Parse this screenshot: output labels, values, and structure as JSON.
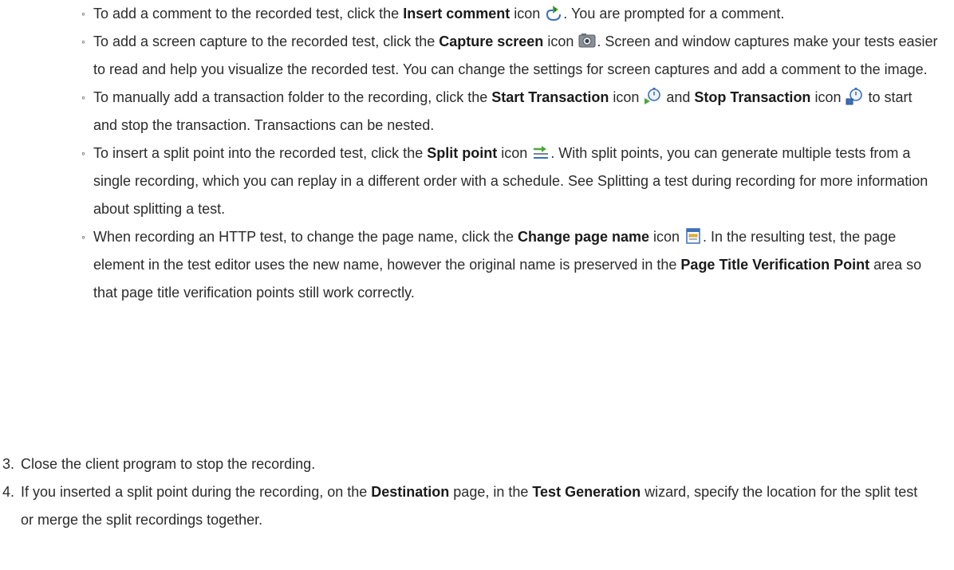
{
  "items": {
    "comment": {
      "pre": "To add a comment to the recorded test, click the ",
      "bold": "Insert comment",
      "mid": " icon ",
      "post": ". You are prompted for a comment.",
      "icon": "insert-comment-icon"
    },
    "capture": {
      "pre": "To add a screen capture to the recorded test, click the ",
      "bold": "Capture screen",
      "mid": " icon ",
      "post": ". Screen and window captures make your tests easier to read and help you visualize the recorded test. You can change the settings for screen captures and add a comment to the image.",
      "icon": "capture-screen-icon"
    },
    "transaction": {
      "pre": "To manually add a transaction folder to the recording, click the ",
      "bold1": "Start Transaction",
      "mid1": " icon ",
      "mid2": " and ",
      "bold2": "Stop Transaction",
      "mid3": " icon ",
      "post": " to start and stop the transaction. Transactions can be nested.",
      "icon1": "start-transaction-icon",
      "icon2": "stop-transaction-icon"
    },
    "split": {
      "pre": "To insert a split point into the recorded test, click the ",
      "bold": "Split point",
      "mid": " icon ",
      "post": ". With split points, you can generate multiple tests from a single recording, which you can replay in a different order with a schedule. See Splitting a test during recording for more information about splitting a test.",
      "icon": "split-point-icon"
    },
    "page_name": {
      "pre": "When recording an HTTP test, to change the page name, click the ",
      "bold1": "Change page name",
      "mid": " icon ",
      "post1": ". In the resulting test, the page element in the test editor uses the new name, however the original name is preserved in the ",
      "bold2": "Page Title Verification Point",
      "post2": " area so that page title verification points still work correctly.",
      "icon": "change-page-name-icon"
    }
  },
  "steps": [
    {
      "num": "3.",
      "text": "Close the client program to stop the recording."
    },
    {
      "num": "4.",
      "pre": "If you inserted a split point during the recording, on the ",
      "bold1": "Destination",
      "mid": " page, in the ",
      "bold2": "Test Generation",
      "post": " wizard, specify the location for the split test or merge the split recordings together."
    }
  ]
}
